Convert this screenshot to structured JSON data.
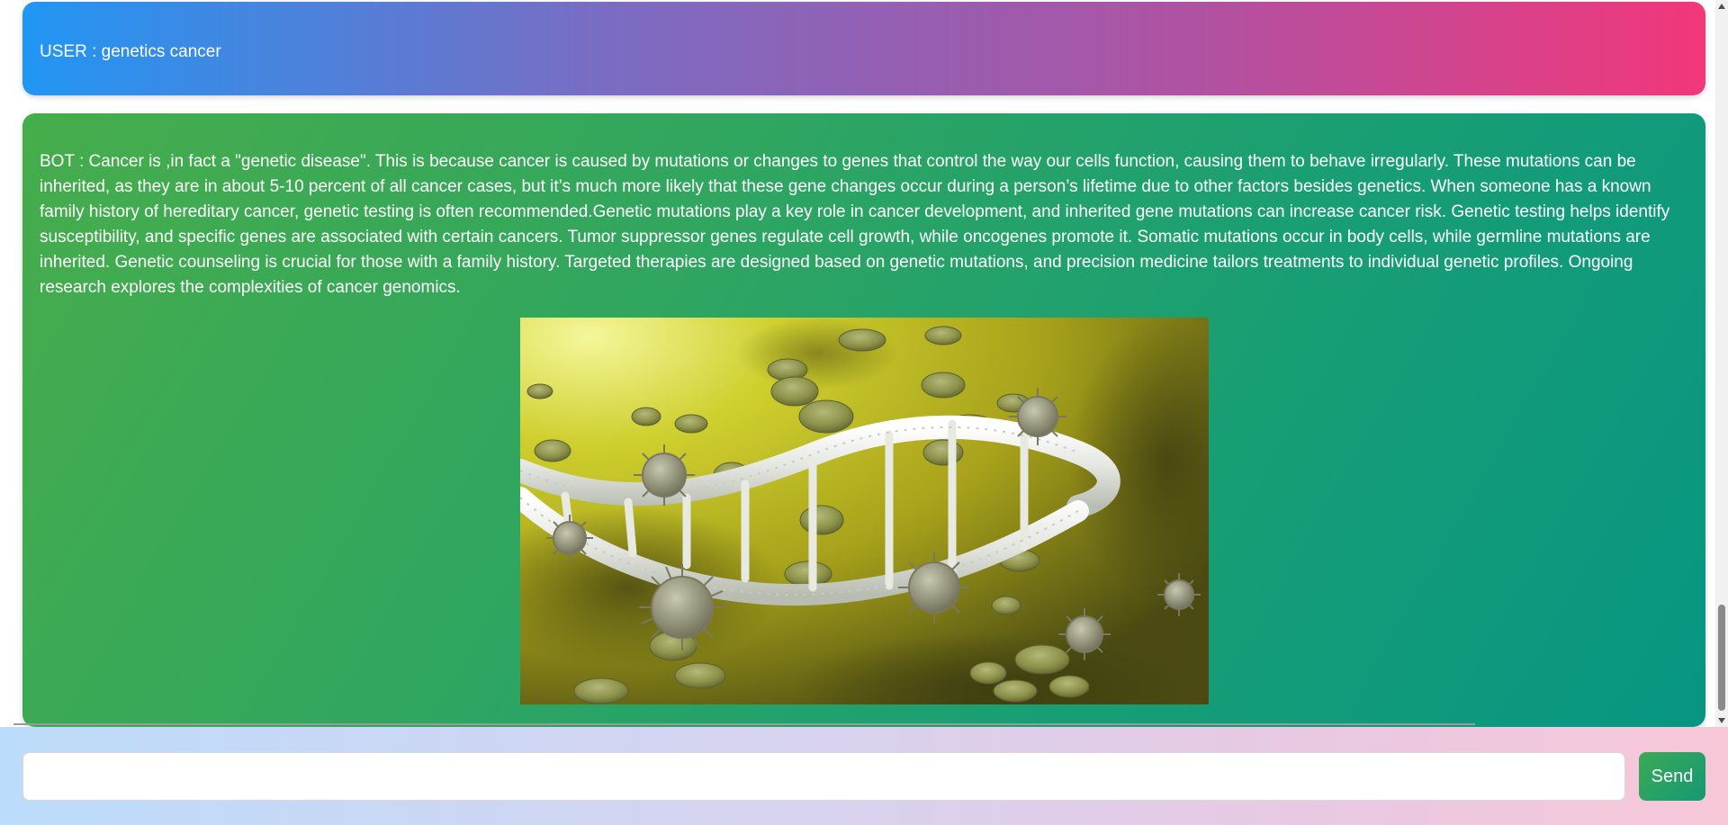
{
  "chat": {
    "user_message": "USER : genetics cancer",
    "bot_message": "BOT : Cancer is ,in fact a \"genetic disease\". This is because cancer is caused by mutations or changes to genes that control the way our cells function, causing them to behave irregularly. These mutations can be inherited, as they are in about 5-10 percent of all cancer cases, but it’s much more likely that these gene changes occur during a person’s lifetime due to other factors besides genetics. When someone has a known family history of hereditary cancer, genetic testing is often recommended.Genetic mutations play a key role in cancer development, and inherited gene mutations can increase cancer risk. Genetic testing helps identify susceptibility, and specific genes are associated with certain cancers. Tumor suppressor genes regulate cell growth, while oncogenes promote it. Somatic mutations occur in body cells, while germline mutations are inherited. Genetic counseling is crucial for those with a family history. Targeted therapies are designed based on genetic mutations, and precision medicine tailors treatments to individual genetic profiles. Ongoing research explores the complexities of cancer genomics."
  },
  "input": {
    "value": "",
    "placeholder": ""
  },
  "send_label": "Send",
  "colors": {
    "user_gradient_start": "#2196f3",
    "user_gradient_end": "#f2377a",
    "bot_gradient_start": "#46ad4b",
    "bot_gradient_end": "#079683",
    "send_button": "#2a9f64"
  },
  "icons": {
    "bot_image": "dna-helix-with-cancer-cells-image",
    "scroll_up": "chevron-up-icon",
    "scroll_down": "chevron-down-icon"
  }
}
